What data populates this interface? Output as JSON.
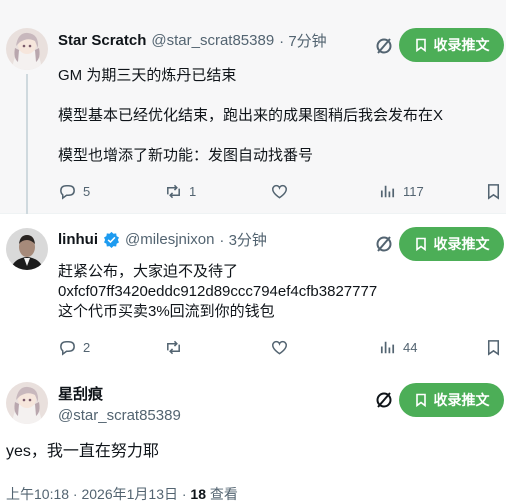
{
  "posts": [
    {
      "name": "Star Scratch",
      "handle": "@star_scrat85389",
      "time": "· 7分钟",
      "lines": [
        "GM 为期三天的炼丹已结束",
        "",
        "模型基本已经优化结束，跑出来的成果图稍后我会发布在X",
        "",
        "模型也增添了新功能：发图自动找番号"
      ],
      "replies": "5",
      "reposts": "1",
      "likes": "",
      "views": "117",
      "collect_label": "收录推文"
    },
    {
      "name": "linhui",
      "handle": "@milesjnixon",
      "time": "· 3分钟",
      "lines": [
        "赶紧公布，大家迫不及待了",
        "0xfcf07ff3420eddc912d89ccc794ef4cfb3827777",
        "这个代币买卖3%回流到你的钱包"
      ],
      "replies": "2",
      "reposts": "",
      "likes": "",
      "views": "44",
      "collect_label": "收录推文"
    },
    {
      "name": "星刮痕",
      "handle": "@star_scrat85389",
      "lines": [
        "yes，我一直在努力耶"
      ],
      "collect_label": "收录推文",
      "footer_time": "上午10:18 · 2026年1月13日 · ",
      "footer_views": "18",
      "footer_views_label": " 查看"
    }
  ],
  "colors": {
    "accent_green": "#4cae57",
    "verified_blue": "#1d9bf0",
    "muted": "#536471"
  }
}
